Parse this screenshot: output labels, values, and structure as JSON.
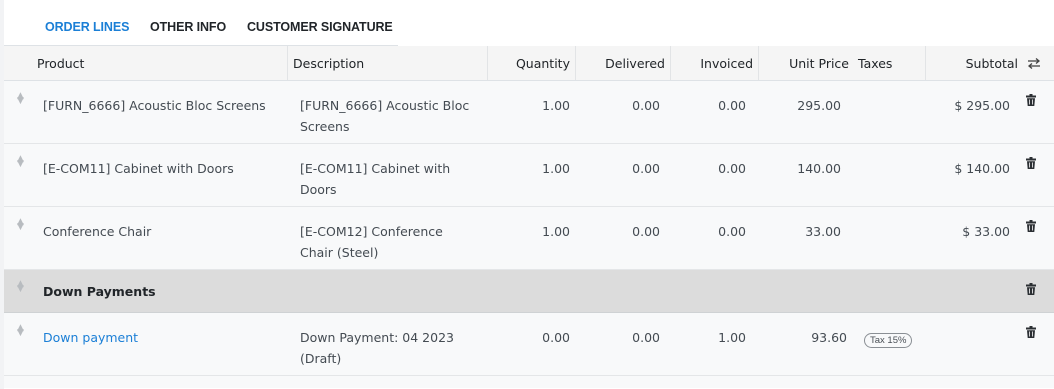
{
  "tabs": [
    {
      "label": "ORDER LINES",
      "active": true
    },
    {
      "label": "OTHER INFO",
      "active": false
    },
    {
      "label": "CUSTOMER SIGNATURE",
      "active": false
    }
  ],
  "columns": {
    "product": "Product",
    "description": "Description",
    "quantity": "Quantity",
    "delivered": "Delivered",
    "invoiced": "Invoiced",
    "unit_price": "Unit Price",
    "taxes": "Taxes",
    "subtotal": "Subtotal"
  },
  "lines": [
    {
      "product": "[FURN_6666] Acoustic Bloc Screens",
      "description": "[FURN_6666] Acoustic Bloc Screens",
      "quantity": "1.00",
      "delivered": "0.00",
      "invoiced": "0.00",
      "unit_price": "295.00",
      "subtotal": "$ 295.00"
    },
    {
      "product": "[E-COM11] Cabinet with Doors",
      "description": "[E-COM11] Cabinet with Doors",
      "quantity": "1.00",
      "delivered": "0.00",
      "invoiced": "0.00",
      "unit_price": "140.00",
      "subtotal": "$ 140.00"
    },
    {
      "product": "Conference Chair",
      "description": "[E-COM12] Conference Chair (Steel)",
      "quantity": "1.00",
      "delivered": "0.00",
      "invoiced": "0.00",
      "unit_price": "33.00",
      "subtotal": "$ 33.00"
    }
  ],
  "section": {
    "label": "Down Payments"
  },
  "down_payment": {
    "product": "Down payment",
    "description": "Down Payment: 04 2023 (Draft)",
    "quantity": "0.00",
    "delivered": "0.00",
    "invoiced": "1.00",
    "unit_price": "93.60",
    "tax": "Tax 15%"
  },
  "colors": {
    "accent": "#1b7fd6",
    "section_bg": "#dcdcdc",
    "row_bg": "#f8f9fa"
  },
  "icons": {
    "drag": "drag-handle-icon",
    "delete": "trash-icon",
    "settings": "optional-columns-icon"
  }
}
